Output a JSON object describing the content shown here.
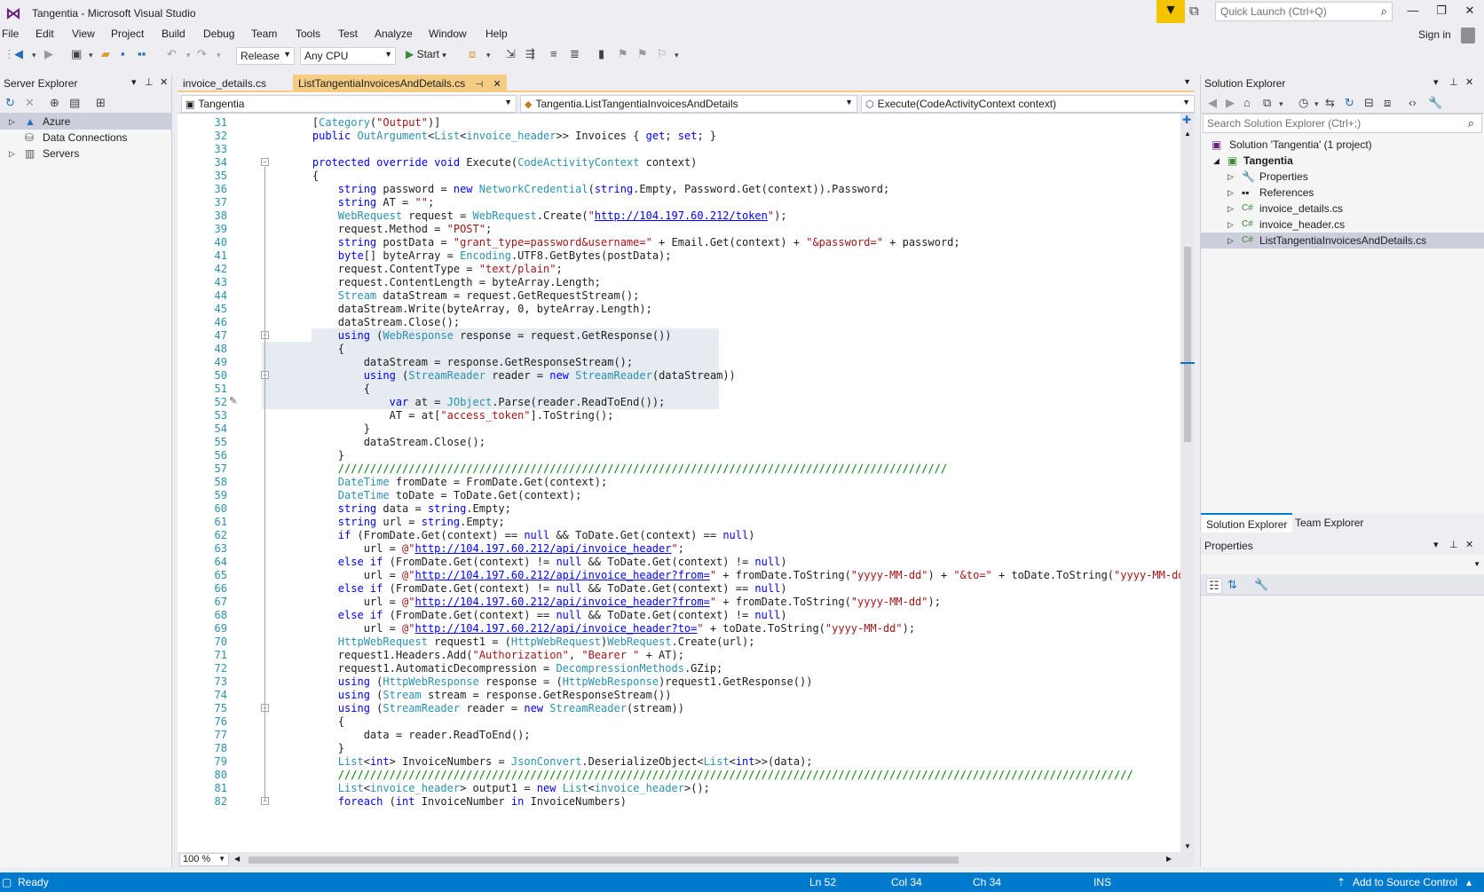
{
  "window": {
    "title": "Tangentia - Microsoft Visual Studio",
    "quick_launch_placeholder": "Quick Launch (Ctrl+Q)",
    "sign_in": "Sign in"
  },
  "menu": [
    "File",
    "Edit",
    "View",
    "Project",
    "Build",
    "Debug",
    "Team",
    "Tools",
    "Test",
    "Analyze",
    "Window",
    "Help"
  ],
  "toolbar": {
    "config": "Release",
    "platform": "Any CPU",
    "start": "Start"
  },
  "server_explorer": {
    "title": "Server Explorer",
    "items": [
      "Azure",
      "Data Connections",
      "Servers"
    ]
  },
  "editor": {
    "tabs": [
      "invoice_details.cs",
      "ListTangentiaInvoicesAndDetails.cs"
    ],
    "nav": {
      "project": "Tangentia",
      "class": "Tangentia.ListTangentiaInvoicesAndDetails",
      "member": "Execute(CodeActivityContext context)"
    },
    "zoom": "100 %",
    "lines": [
      {
        "n": "31",
        "segs": [
          [
            "",
            "    ["
          ],
          [
            "ty",
            "Category"
          ],
          [
            "",
            "("
          ],
          [
            "st",
            "\"Output\""
          ],
          [
            "",
            ")]"
          ]
        ]
      },
      {
        "n": "32",
        "segs": [
          [
            "kw",
            "    public "
          ],
          [
            "ty",
            "OutArgument"
          ],
          [
            "",
            "<"
          ],
          [
            "ty",
            "List"
          ],
          [
            "",
            "<"
          ],
          [
            "ty",
            "invoice_header"
          ],
          [
            "",
            ">> Invoices { "
          ],
          [
            "kw",
            "get"
          ],
          [
            "",
            "; "
          ],
          [
            "kw",
            "set"
          ],
          [
            "",
            "; }"
          ]
        ]
      },
      {
        "n": "33",
        "segs": [
          [
            "",
            ""
          ]
        ]
      },
      {
        "n": "34",
        "segs": [
          [
            "kw",
            "    protected override void "
          ],
          [
            "",
            "Execute("
          ],
          [
            "ty",
            "CodeActivityContext"
          ],
          [
            "",
            " context)"
          ]
        ]
      },
      {
        "n": "35",
        "segs": [
          [
            "",
            "    {"
          ]
        ]
      },
      {
        "n": "36",
        "segs": [
          [
            "kw",
            "        string "
          ],
          [
            "",
            "password = "
          ],
          [
            "kw",
            "new "
          ],
          [
            "ty",
            "NetworkCredential"
          ],
          [
            "",
            "("
          ],
          [
            "kw",
            "string"
          ],
          [
            "",
            ".Empty, Password.Get(context)).Password;"
          ]
        ]
      },
      {
        "n": "37",
        "segs": [
          [
            "kw",
            "        string "
          ],
          [
            "",
            "AT = "
          ],
          [
            "st",
            "\"\""
          ],
          [
            "",
            ";"
          ]
        ]
      },
      {
        "n": "38",
        "segs": [
          [
            "ty",
            "        WebRequest "
          ],
          [
            "",
            "request = "
          ],
          [
            "ty",
            "WebRequest"
          ],
          [
            "",
            ".Create("
          ],
          [
            "st",
            "\""
          ],
          [
            "ur",
            "http://104.197.60.212/token"
          ],
          [
            "st",
            "\""
          ],
          [
            "",
            ");"
          ]
        ]
      },
      {
        "n": "39",
        "segs": [
          [
            "",
            "        request.Method = "
          ],
          [
            "st",
            "\"POST\""
          ],
          [
            "",
            ";"
          ]
        ]
      },
      {
        "n": "40",
        "segs": [
          [
            "kw",
            "        string "
          ],
          [
            "",
            "postData = "
          ],
          [
            "st",
            "\"grant_type=password&username=\""
          ],
          [
            "",
            " + Email.Get(context) + "
          ],
          [
            "st",
            "\"&password=\""
          ],
          [
            "",
            " + password;"
          ]
        ]
      },
      {
        "n": "41",
        "segs": [
          [
            "kw",
            "        byte"
          ],
          [
            "",
            "[] byteArray = "
          ],
          [
            "ty",
            "Encoding"
          ],
          [
            "",
            ".UTF8.GetBytes(postData);"
          ]
        ]
      },
      {
        "n": "42",
        "segs": [
          [
            "",
            "        request.ContentType = "
          ],
          [
            "st",
            "\"text/plain\""
          ],
          [
            "",
            ";"
          ]
        ]
      },
      {
        "n": "43",
        "segs": [
          [
            "",
            "        request.ContentLength = byteArray.Length;"
          ]
        ]
      },
      {
        "n": "44",
        "segs": [
          [
            "ty",
            "        Stream "
          ],
          [
            "",
            "dataStream = request.GetRequestStream();"
          ]
        ]
      },
      {
        "n": "45",
        "segs": [
          [
            "",
            "        dataStream.Write(byteArray, 0, byteArray.Length);"
          ]
        ]
      },
      {
        "n": "46",
        "segs": [
          [
            "",
            "        dataStream.Close();"
          ]
        ]
      },
      {
        "n": "47",
        "segs": [
          [
            "kw",
            "        using "
          ],
          [
            "",
            "("
          ],
          [
            "ty",
            "WebResponse"
          ],
          [
            "",
            " response = request.GetResponse())"
          ]
        ]
      },
      {
        "n": "48",
        "segs": [
          [
            "",
            "        {"
          ]
        ]
      },
      {
        "n": "49",
        "segs": [
          [
            "",
            "            dataStream = response.GetResponseStream();"
          ]
        ]
      },
      {
        "n": "50",
        "segs": [
          [
            "kw",
            "            using "
          ],
          [
            "",
            "("
          ],
          [
            "ty",
            "StreamReader"
          ],
          [
            "",
            " reader = "
          ],
          [
            "kw",
            "new "
          ],
          [
            "ty",
            "StreamReader"
          ],
          [
            "",
            "(dataStream))"
          ]
        ]
      },
      {
        "n": "51",
        "segs": [
          [
            "",
            "            {"
          ]
        ]
      },
      {
        "n": "52",
        "segs": [
          [
            "kw",
            "                var "
          ],
          [
            "",
            "at = "
          ],
          [
            "ty",
            "JObject"
          ],
          [
            "",
            ".Parse(reader.ReadToEnd());"
          ]
        ]
      },
      {
        "n": "53",
        "segs": [
          [
            "",
            "                AT = at["
          ],
          [
            "st",
            "\"access_token\""
          ],
          [
            "",
            "].ToString();"
          ]
        ]
      },
      {
        "n": "54",
        "segs": [
          [
            "",
            "            }"
          ]
        ]
      },
      {
        "n": "55",
        "segs": [
          [
            "",
            "            dataStream.Close();"
          ]
        ]
      },
      {
        "n": "56",
        "segs": [
          [
            "",
            "        }"
          ]
        ]
      },
      {
        "n": "57",
        "segs": [
          [
            "cm",
            "        ///////////////////////////////////////////////////////////////////////////////////////////////"
          ]
        ]
      },
      {
        "n": "58",
        "segs": [
          [
            "ty",
            "        DateTime "
          ],
          [
            "",
            "fromDate = FromDate.Get(context);"
          ]
        ]
      },
      {
        "n": "59",
        "segs": [
          [
            "ty",
            "        DateTime "
          ],
          [
            "",
            "toDate = ToDate.Get(context);"
          ]
        ]
      },
      {
        "n": "60",
        "segs": [
          [
            "kw",
            "        string "
          ],
          [
            "",
            "data = "
          ],
          [
            "kw",
            "string"
          ],
          [
            "",
            ".Empty;"
          ]
        ]
      },
      {
        "n": "61",
        "segs": [
          [
            "kw",
            "        string "
          ],
          [
            "",
            "url = "
          ],
          [
            "kw",
            "string"
          ],
          [
            "",
            ".Empty;"
          ]
        ]
      },
      {
        "n": "62",
        "segs": [
          [
            "kw",
            "        if "
          ],
          [
            "",
            "(FromDate.Get(context) == "
          ],
          [
            "kw",
            "null"
          ],
          [
            "",
            " && ToDate.Get(context) == "
          ],
          [
            "kw",
            "null"
          ],
          [
            "",
            ")"
          ]
        ]
      },
      {
        "n": "63",
        "segs": [
          [
            "",
            "            url = "
          ],
          [
            "st",
            "@\""
          ],
          [
            "ur",
            "http://104.197.60.212/api/invoice_header"
          ],
          [
            "st",
            "\""
          ],
          [
            "",
            ";"
          ]
        ]
      },
      {
        "n": "64",
        "segs": [
          [
            "kw",
            "        else if "
          ],
          [
            "",
            "(FromDate.Get(context) != "
          ],
          [
            "kw",
            "null"
          ],
          [
            "",
            " && ToDate.Get(context) != "
          ],
          [
            "kw",
            "null"
          ],
          [
            "",
            ")"
          ]
        ]
      },
      {
        "n": "65",
        "segs": [
          [
            "",
            "            url = "
          ],
          [
            "st",
            "@\""
          ],
          [
            "ur",
            "http://104.197.60.212/api/invoice_header?from="
          ],
          [
            "st",
            "\""
          ],
          [
            "",
            " + fromDate.ToString("
          ],
          [
            "st",
            "\"yyyy-MM-dd\""
          ],
          [
            "",
            ") + "
          ],
          [
            "st",
            "\"&to=\""
          ],
          [
            "",
            " + toDate.ToString("
          ],
          [
            "st",
            "\"yyyy-MM-dd\""
          ],
          [
            "",
            ");"
          ]
        ]
      },
      {
        "n": "66",
        "segs": [
          [
            "kw",
            "        else if "
          ],
          [
            "",
            "(FromDate.Get(context) != "
          ],
          [
            "kw",
            "null"
          ],
          [
            "",
            " && ToDate.Get(context) == "
          ],
          [
            "kw",
            "null"
          ],
          [
            "",
            ")"
          ]
        ]
      },
      {
        "n": "67",
        "segs": [
          [
            "",
            "            url = "
          ],
          [
            "st",
            "@\""
          ],
          [
            "ur",
            "http://104.197.60.212/api/invoice_header?from="
          ],
          [
            "st",
            "\""
          ],
          [
            "",
            " + fromDate.ToString("
          ],
          [
            "st",
            "\"yyyy-MM-dd\""
          ],
          [
            "",
            ");"
          ]
        ]
      },
      {
        "n": "68",
        "segs": [
          [
            "kw",
            "        else if "
          ],
          [
            "",
            "(FromDate.Get(context) == "
          ],
          [
            "kw",
            "null"
          ],
          [
            "",
            " && ToDate.Get(context) != "
          ],
          [
            "kw",
            "null"
          ],
          [
            "",
            ")"
          ]
        ]
      },
      {
        "n": "69",
        "segs": [
          [
            "",
            "            url = "
          ],
          [
            "st",
            "@\""
          ],
          [
            "ur",
            "http://104.197.60.212/api/invoice_header?to="
          ],
          [
            "st",
            "\""
          ],
          [
            "",
            " + toDate.ToString("
          ],
          [
            "st",
            "\"yyyy-MM-dd\""
          ],
          [
            "",
            ");"
          ]
        ]
      },
      {
        "n": "70",
        "segs": [
          [
            "ty",
            "        HttpWebRequest "
          ],
          [
            "",
            "request1 = ("
          ],
          [
            "ty",
            "HttpWebRequest"
          ],
          [
            "",
            ")"
          ],
          [
            "ty",
            "WebRequest"
          ],
          [
            "",
            ".Create(url);"
          ]
        ]
      },
      {
        "n": "71",
        "segs": [
          [
            "",
            "        request1.Headers.Add("
          ],
          [
            "st",
            "\"Authorization\""
          ],
          [
            "",
            ", "
          ],
          [
            "st",
            "\"Bearer \""
          ],
          [
            "",
            " + AT);"
          ]
        ]
      },
      {
        "n": "72",
        "segs": [
          [
            "",
            "        request1.AutomaticDecompression = "
          ],
          [
            "ty",
            "DecompressionMethods"
          ],
          [
            "",
            ".GZip;"
          ]
        ]
      },
      {
        "n": "73",
        "segs": [
          [
            "kw",
            "        using "
          ],
          [
            "",
            "("
          ],
          [
            "ty",
            "HttpWebResponse"
          ],
          [
            "",
            " response = ("
          ],
          [
            "ty",
            "HttpWebResponse"
          ],
          [
            "",
            ")request1.GetResponse())"
          ]
        ]
      },
      {
        "n": "74",
        "segs": [
          [
            "kw",
            "        using "
          ],
          [
            "",
            "("
          ],
          [
            "ty",
            "Stream"
          ],
          [
            "",
            " stream = response.GetResponseStream())"
          ]
        ]
      },
      {
        "n": "75",
        "segs": [
          [
            "kw",
            "        using "
          ],
          [
            "",
            "("
          ],
          [
            "ty",
            "StreamReader"
          ],
          [
            "",
            " reader = "
          ],
          [
            "kw",
            "new "
          ],
          [
            "ty",
            "StreamReader"
          ],
          [
            "",
            "(stream))"
          ]
        ]
      },
      {
        "n": "76",
        "segs": [
          [
            "",
            "        {"
          ]
        ]
      },
      {
        "n": "77",
        "segs": [
          [
            "",
            "            data = reader.ReadToEnd();"
          ]
        ]
      },
      {
        "n": "78",
        "segs": [
          [
            "",
            "        }"
          ]
        ]
      },
      {
        "n": "79",
        "segs": [
          [
            "ty",
            "        List"
          ],
          [
            "",
            "<"
          ],
          [
            "kw",
            "int"
          ],
          [
            "",
            "> InvoiceNumbers = "
          ],
          [
            "ty",
            "JsonConvert"
          ],
          [
            "",
            ".DeserializeObject<"
          ],
          [
            "ty",
            "List"
          ],
          [
            "",
            "<"
          ],
          [
            "kw",
            "int"
          ],
          [
            "",
            ">>(data);"
          ]
        ]
      },
      {
        "n": "80",
        "segs": [
          [
            "cm",
            "        ////////////////////////////////////////////////////////////////////////////////////////////////////////////////////////////"
          ]
        ]
      },
      {
        "n": "81",
        "segs": [
          [
            "ty",
            "        List"
          ],
          [
            "",
            "<"
          ],
          [
            "ty",
            "invoice_header"
          ],
          [
            "",
            "> output1 = "
          ],
          [
            "kw",
            "new "
          ],
          [
            "ty",
            "List"
          ],
          [
            "",
            "<"
          ],
          [
            "ty",
            "invoice_header"
          ],
          [
            "",
            ">();"
          ]
        ]
      },
      {
        "n": "82",
        "segs": [
          [
            "kw",
            "        foreach "
          ],
          [
            "",
            "("
          ],
          [
            "kw",
            "int"
          ],
          [
            "",
            " InvoiceNumber "
          ],
          [
            "kw",
            "in"
          ],
          [
            "",
            " InvoiceNumbers)"
          ]
        ]
      }
    ]
  },
  "solution_explorer": {
    "title": "Solution Explorer",
    "search_placeholder": "Search Solution Explorer (Ctrl+;)",
    "solution": "Solution 'Tangentia' (1 project)",
    "project": "Tangentia",
    "items": [
      "Properties",
      "References",
      "invoice_details.cs",
      "invoice_header.cs",
      "ListTangentiaInvoicesAndDetails.cs"
    ],
    "tabs": [
      "Solution Explorer",
      "Team Explorer"
    ]
  },
  "properties": {
    "title": "Properties"
  },
  "status": {
    "ready": "Ready",
    "ln": "Ln 52",
    "col": "Col 34",
    "ch": "Ch 34",
    "mode": "INS",
    "source_control": "Add to Source Control"
  },
  "colors": {
    "accent": "#007ACC",
    "tab_active": "#F5CC84",
    "filter": "#F5C400"
  }
}
